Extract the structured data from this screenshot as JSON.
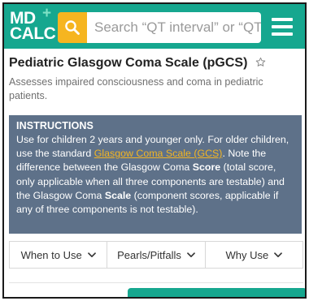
{
  "header": {
    "logo_line1": "MD",
    "logo_line2": "CALC",
    "logo_plus": "+",
    "search_placeholder": "Search “QT interval” or “QT",
    "colors": {
      "bar": "#16a78f",
      "search_button": "#f6b520"
    },
    "icons": {
      "search": "search-icon",
      "menu": "hamburger-menu-icon"
    }
  },
  "page": {
    "title": "Pediatric Glasgow Coma Scale (pGCS)",
    "subtitle": "Assesses impaired consciousness and coma in pediatric patients.",
    "favorite_icon": "star-outline-icon"
  },
  "instructions": {
    "heading": "INSTRUCTIONS",
    "text_1": "Use for children 2 years and younger only. For older children, use the standard ",
    "link": "Glasgow Coma Scale (GCS)",
    "text_2": ". Note the difference between the Glasgow Coma ",
    "bold_1": "Score",
    "text_3": " (total score, only applicable when all three components are testable) and the Glasgow Coma ",
    "bold_2": "Scale",
    "text_4": " (component scores, applicable if any of three components is not testable).",
    "colors": {
      "panel": "#5e7189",
      "link": "#f3b523"
    }
  },
  "tabs": [
    {
      "label": "When to Use"
    },
    {
      "label": "Pearls/Pitfalls"
    },
    {
      "label": "Why Use"
    }
  ]
}
